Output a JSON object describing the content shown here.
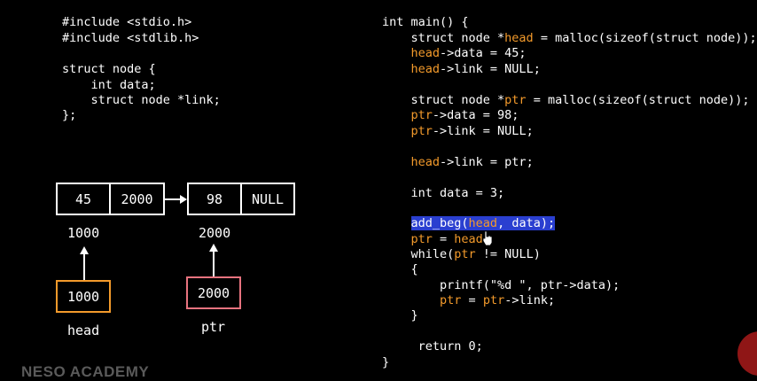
{
  "left_code": {
    "lines": [
      "#include <stdio.h>",
      "#include <stdlib.h>",
      "",
      "struct node {",
      "    int data;",
      "    struct node *link;",
      "};"
    ]
  },
  "diagram": {
    "node1": {
      "data": "45",
      "link": "2000",
      "address": "1000"
    },
    "node2": {
      "data": "98",
      "link": "NULL",
      "address": "2000"
    },
    "head_ptr": {
      "value": "1000",
      "name": "head"
    },
    "ptr_ptr": {
      "value": "2000",
      "name": "ptr"
    }
  },
  "right_code": {
    "l1": "int main() {",
    "l2a": "    struct node *",
    "l2b": "head",
    "l2c": " = malloc(sizeof(struct node));",
    "l3a": "    ",
    "l3b": "head",
    "l3c": "->data = 45;",
    "l4b": "head",
    "l4c": "->link = NULL;",
    "l5a": "    struct node *",
    "l5b": "ptr",
    "l5c": " = malloc(sizeof(struct node));",
    "l6b": "ptr",
    "l6c": "->data = 98;",
    "l7b": "ptr",
    "l7c": "->link = NULL;",
    "l8b": "head",
    "l8c": "->link = ptr;",
    "l9": "    int data = 3;",
    "l10a": "add_beg(",
    "l10b": "head",
    "l10c": ", data);",
    "l11b": "ptr",
    "l11c": " = ",
    "l11d": "head",
    "l11e": ";",
    "l12a": "    while(",
    "l12b": "ptr",
    "l12c": " != NULL)",
    "l13": "    {",
    "l14": "        printf(\"%d \", ptr->data);",
    "l15b": "ptr",
    "l15c": " = ",
    "l15d": "ptr",
    "l15e": "->link;",
    "l16": "    }",
    "l17": "     return 0;",
    "l18": "}"
  },
  "watermark": "NESO ACADEMY",
  "colors": {
    "highlight": "#f39a2b",
    "selection": "#2a3fd0",
    "head_box": "#f39a2b",
    "ptr_box": "#e8737f"
  }
}
